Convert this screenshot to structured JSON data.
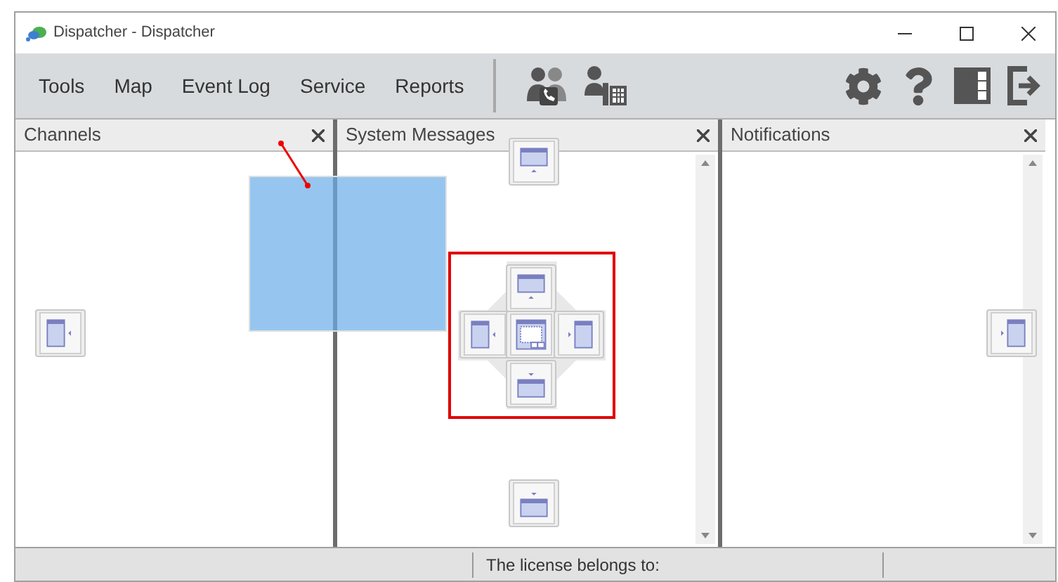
{
  "window": {
    "title": "Dispatcher - Dispatcher"
  },
  "menu": [
    {
      "label": "Tools"
    },
    {
      "label": "Map"
    },
    {
      "label": "Event Log"
    },
    {
      "label": "Service"
    },
    {
      "label": "Reports"
    }
  ],
  "panels": [
    {
      "title": "Channels",
      "scrollbar": false
    },
    {
      "title": "System Messages",
      "scrollbar": true
    },
    {
      "title": "Notifications",
      "scrollbar": true
    }
  ],
  "status_bar": {
    "text": "The license belongs to:"
  }
}
